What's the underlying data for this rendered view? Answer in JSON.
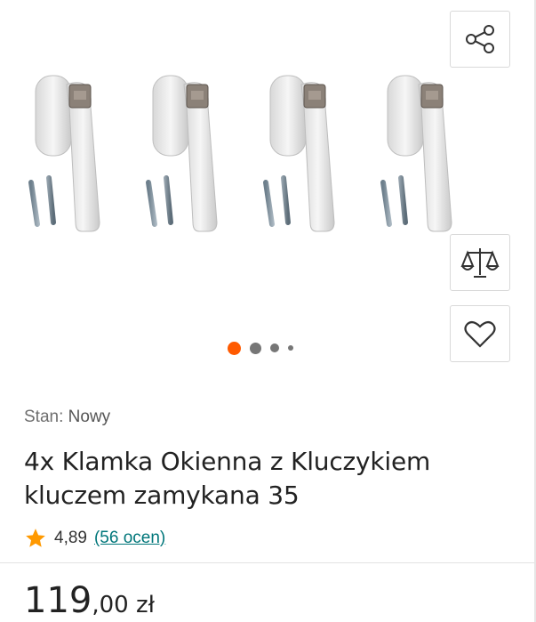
{
  "gallery": {
    "image_alt": "4x Klamka Okienna z Kluczykiem",
    "dots_count": 4,
    "active_dot": 0
  },
  "actions": {
    "share_icon": "share-icon",
    "compare_icon": "scales-icon",
    "favorite_icon": "heart-icon"
  },
  "condition": {
    "label": "Stan:",
    "value": "Nowy"
  },
  "product": {
    "title_line1": "4x Klamka Okienna z Kluczykiem",
    "title_line2": "kluczem zamykana 35"
  },
  "rating": {
    "star_icon": "star-icon",
    "value": "4,89",
    "count_link": "(56 ocen)"
  },
  "price": {
    "whole": "119",
    "fraction": ",00 zł"
  },
  "colors": {
    "accent": "#ff5a00",
    "link": "#00767a",
    "star": "#ff9900"
  }
}
